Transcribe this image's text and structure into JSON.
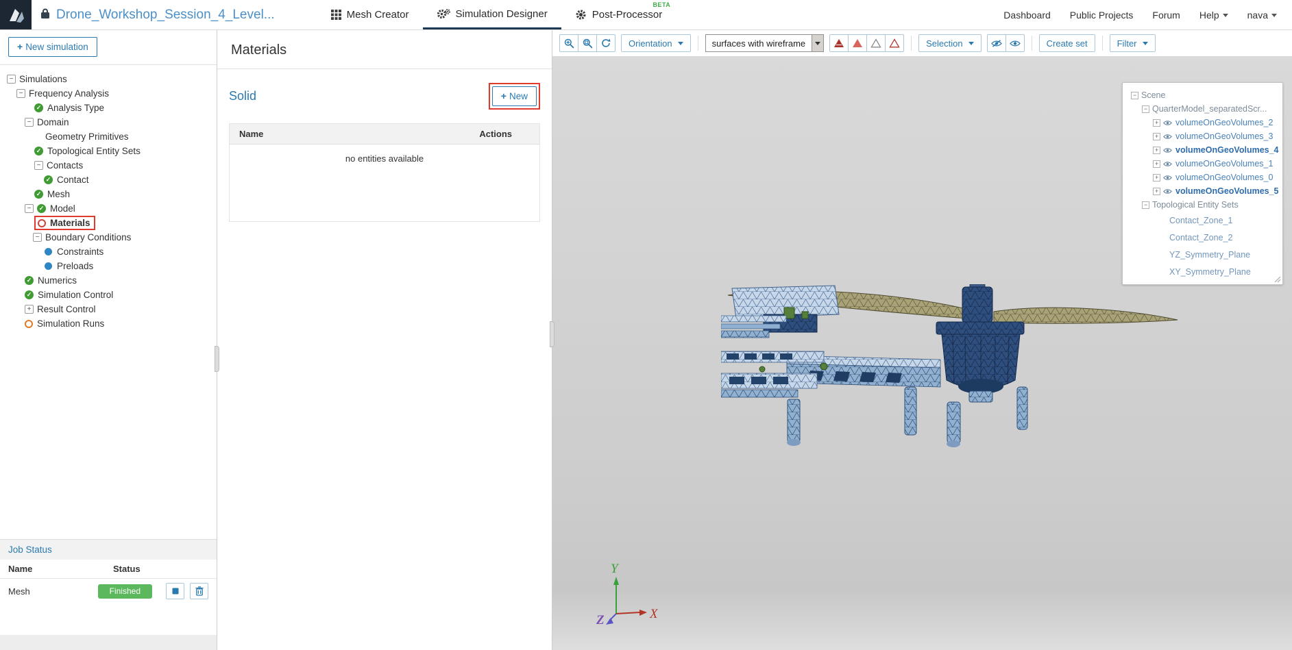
{
  "icons": {
    "plus": "+",
    "minus": "−",
    "check": "✓"
  },
  "colors": {
    "accent_blue": "#2a7ab0",
    "link_blue": "#4b8fc8",
    "status_green": "#5cb85c",
    "annotation_red": "#e0392e",
    "check_green": "#3f9b32",
    "dot_blue": "#2e86c5",
    "warn_orange": "#e07b27",
    "error_red": "#d04437",
    "beta_green": "#3fae49"
  },
  "topbar": {
    "title": "Drone_Workshop_Session_4_Level...",
    "tabs": [
      {
        "label": "Mesh Creator"
      },
      {
        "label": "Simulation Designer"
      },
      {
        "label": "Post-Processor",
        "badge": "BETA"
      }
    ],
    "nav": {
      "dashboard": "Dashboard",
      "public_projects": "Public Projects",
      "forum": "Forum",
      "help": "Help",
      "user": "nava"
    }
  },
  "sidebar": {
    "new_button_label": "New simulation",
    "tree": [
      {
        "label": "Simulations"
      },
      {
        "label": "Frequency Analysis"
      },
      {
        "label": "Analysis Type"
      },
      {
        "label": "Domain"
      },
      {
        "label": "Geometry Primitives"
      },
      {
        "label": "Topological Entity Sets"
      },
      {
        "label": "Contacts"
      },
      {
        "label": "Contact"
      },
      {
        "label": "Mesh"
      },
      {
        "label": "Model"
      },
      {
        "label": "Materials"
      },
      {
        "label": "Boundary Conditions"
      },
      {
        "label": "Constraints"
      },
      {
        "label": "Preloads"
      },
      {
        "label": "Numerics"
      },
      {
        "label": "Simulation Control"
      },
      {
        "label": "Result Control"
      },
      {
        "label": "Simulation Runs"
      }
    ],
    "job": {
      "title": "Job Status",
      "col_name": "Name",
      "col_status": "Status",
      "row_name": "Mesh",
      "row_status": "Finished"
    }
  },
  "materials_panel": {
    "title": "Materials",
    "section_title": "Solid",
    "new_button_label": "New",
    "col_name": "Name",
    "col_actions": "Actions",
    "empty_text": "no entities available"
  },
  "viewport": {
    "toolbar": {
      "orientation": "Orientation",
      "display_mode": "surfaces with wireframe",
      "selection": "Selection",
      "create_set": "Create set",
      "filter": "Filter"
    },
    "scene": [
      {
        "label": "Scene"
      },
      {
        "label": "QuarterModel_separatedScr..."
      },
      {
        "label": "volumeOnGeoVolumes_2"
      },
      {
        "label": "volumeOnGeoVolumes_3"
      },
      {
        "label": "volumeOnGeoVolumes_4"
      },
      {
        "label": "volumeOnGeoVolumes_1"
      },
      {
        "label": "volumeOnGeoVolumes_0"
      },
      {
        "label": "volumeOnGeoVolumes_5"
      },
      {
        "label": "Topological Entity Sets"
      },
      {
        "label": "Contact_Zone_1"
      },
      {
        "label": "Contact_Zone_2"
      },
      {
        "label": "YZ_Symmetry_Plane"
      },
      {
        "label": "XY_Symmetry_Plane"
      }
    ],
    "axes": {
      "x": "X",
      "y": "Y",
      "z": "Z"
    }
  }
}
